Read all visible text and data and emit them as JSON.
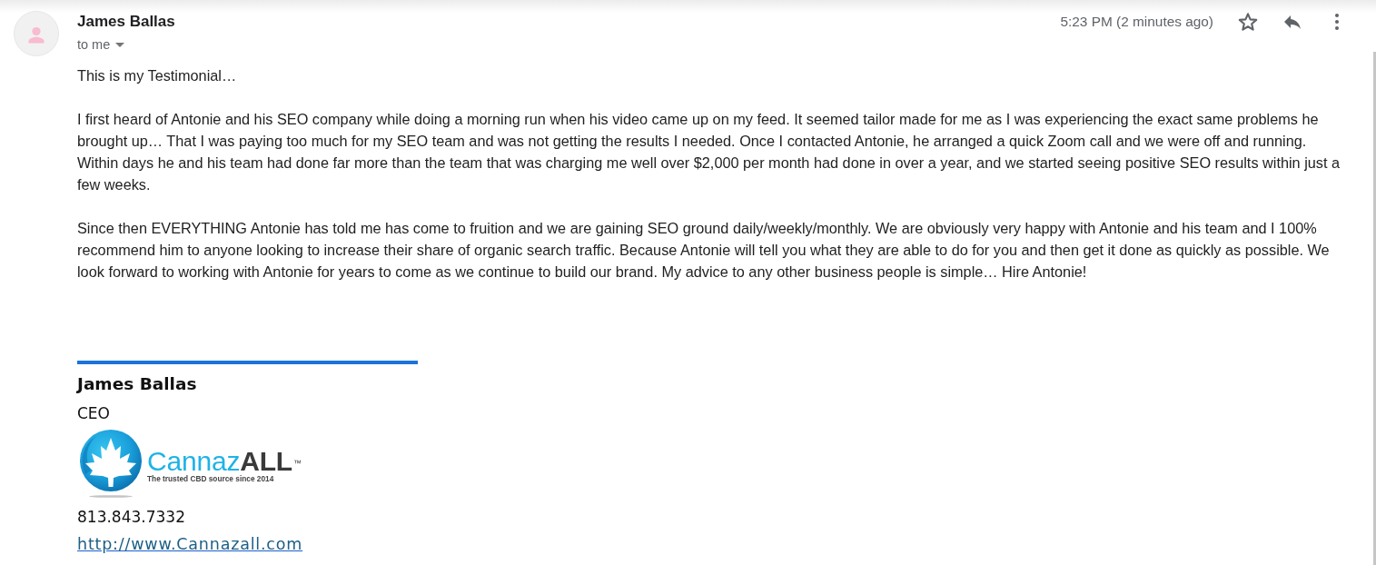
{
  "header": {
    "sender": "James Ballas",
    "recipient_line": "to me",
    "time": "5:23 PM (2 minutes ago)",
    "starred": false
  },
  "body": {
    "paragraphs": [
      "This is my Testimonial…",
      "I first heard of Antonie and his SEO company while doing a morning run when his video came up on my feed. It seemed tailor made for me as I was experiencing the exact same problems he brought up… That I was paying too much for my SEO team and was not getting the results I needed. Once I contacted Antonie, he arranged a quick Zoom call and we were off and running. Within days he and his team had done far more than the team that was charging me well over $2,000 per month had done in over a year, and we started seeing positive SEO results within just a few weeks.",
      "Since then EVERYTHING Antonie has told me has come to fruition and we are gaining SEO ground daily/weekly/monthly. We are obviously very happy with Antonie and his team and I 100% recommend him to anyone looking to increase their share of organic search traffic. Because Antonie will tell you what they are able to do for you and then get it done as quickly as possible. We look forward to working with Antonie for years to come as we continue to build our brand. My advice to any other business people is simple… Hire Antonie!"
    ]
  },
  "signature": {
    "name": "James Ballas",
    "title": "CEO",
    "logo": {
      "brand_first": "Cannaz",
      "brand_second": "ALL",
      "trademark": "™",
      "tagline": "The trusted CBD source since 2014"
    },
    "phone": "813.843.7332",
    "website": "http://www.Cannazall.com"
  }
}
